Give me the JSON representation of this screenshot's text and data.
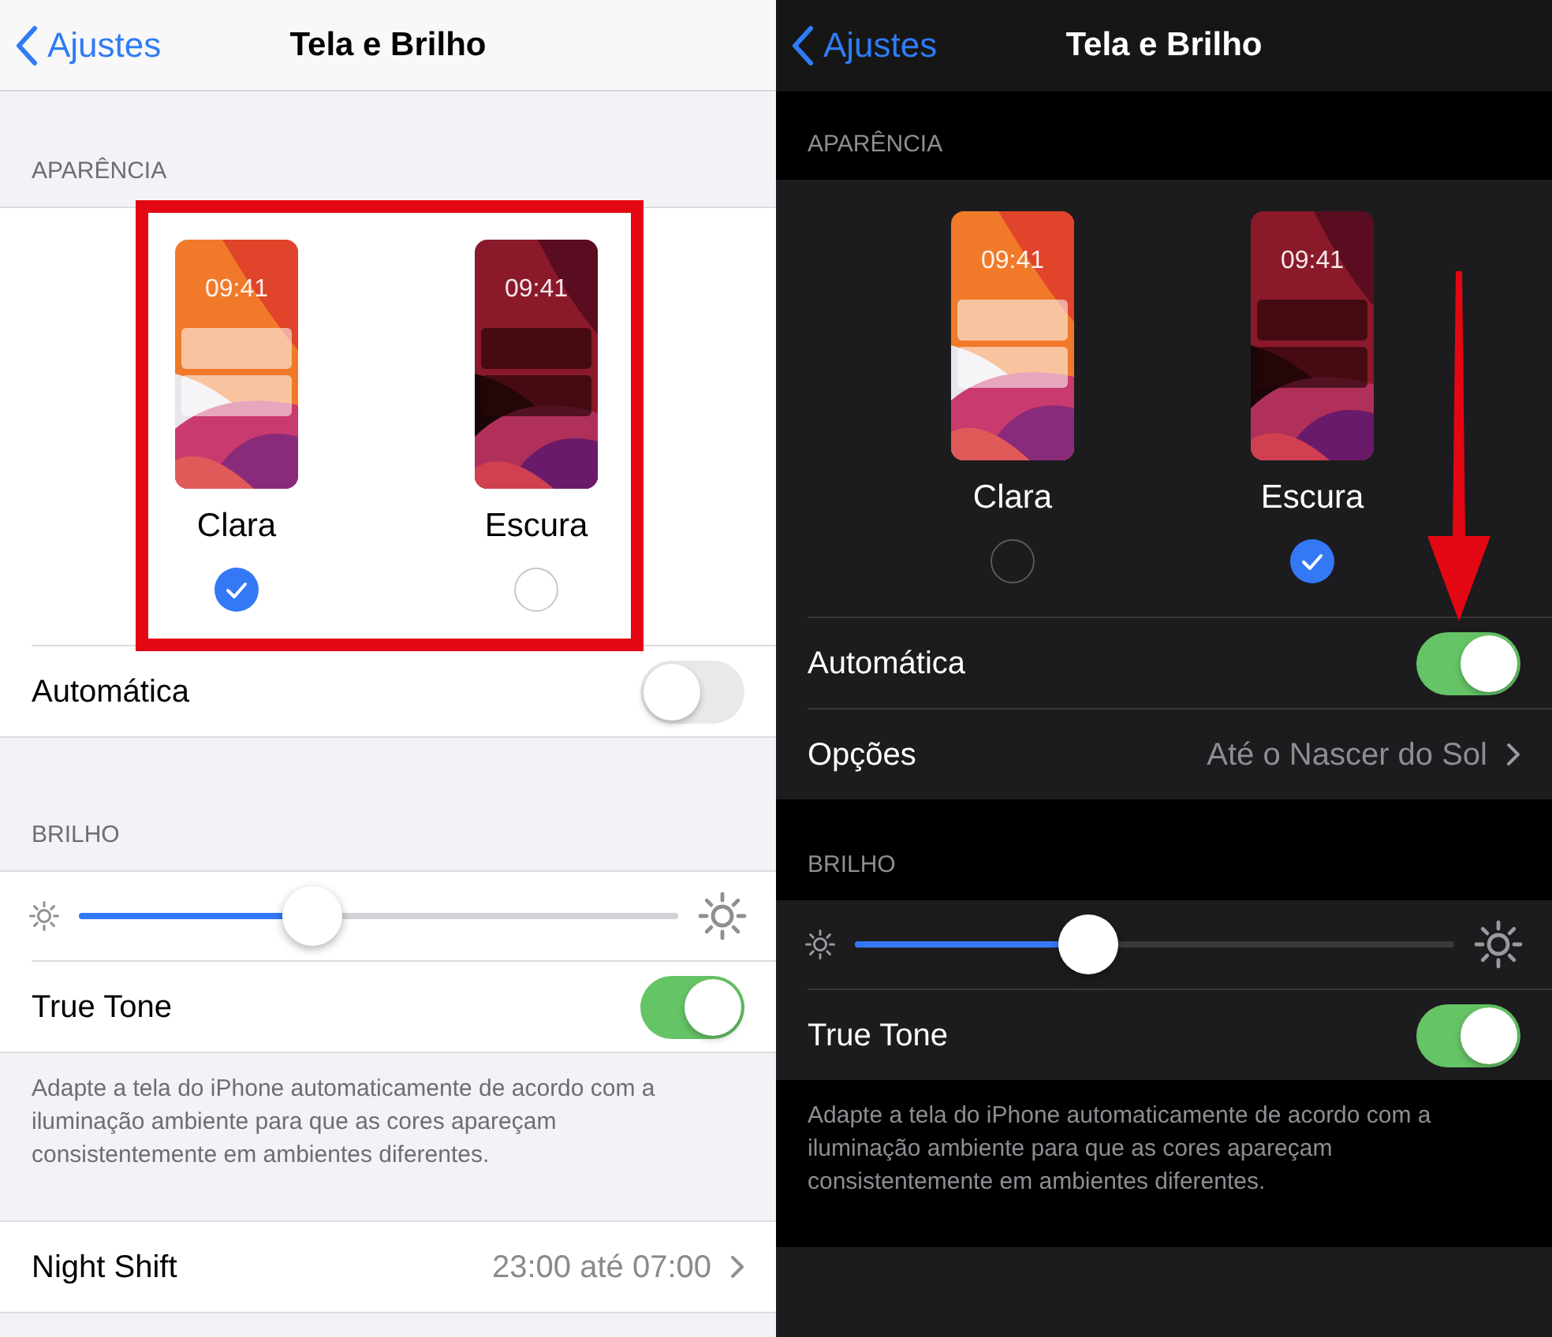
{
  "panels": [
    {
      "kind": "light",
      "nav": {
        "back": "Ajustes",
        "title": "Tela e Brilho"
      },
      "appearance": {
        "header": "APARÊNCIA",
        "highlighted": true,
        "options": [
          {
            "label": "Clara",
            "time": "09:41",
            "kind": "light",
            "selected": true
          },
          {
            "label": "Escura",
            "time": "09:41",
            "kind": "dark",
            "selected": false
          }
        ]
      },
      "automatic": {
        "label": "Automática",
        "on": false
      },
      "brightness": {
        "header": "BRILHO",
        "level": 0.39
      },
      "true_tone": {
        "label": "True Tone",
        "on": true,
        "footnote": "Adapte a tela do iPhone automaticamente de acordo com a iluminação ambiente para que as cores apareçam consistentemente em ambientes diferentes."
      },
      "night_shift": {
        "label": "Night Shift",
        "value": "23:00 até 07:00"
      },
      "arrow": false
    },
    {
      "kind": "dark",
      "nav": {
        "back": "Ajustes",
        "title": "Tela e Brilho"
      },
      "appearance": {
        "header": "APARÊNCIA",
        "highlighted": false,
        "options": [
          {
            "label": "Clara",
            "time": "09:41",
            "kind": "light",
            "selected": false
          },
          {
            "label": "Escura",
            "time": "09:41",
            "kind": "dark",
            "selected": true
          }
        ]
      },
      "automatic": {
        "label": "Automática",
        "on": true
      },
      "schedule": {
        "label": "Opções",
        "value": "Até o Nascer do Sol"
      },
      "brightness": {
        "header": "BRILHO",
        "level": 0.39
      },
      "true_tone": {
        "label": "True Tone",
        "on": true,
        "footnote": "Adapte a tela do iPhone automaticamente de acordo com a iluminação ambiente para que as cores apareçam consistentemente em ambientes diferentes."
      },
      "arrow": true
    }
  ]
}
